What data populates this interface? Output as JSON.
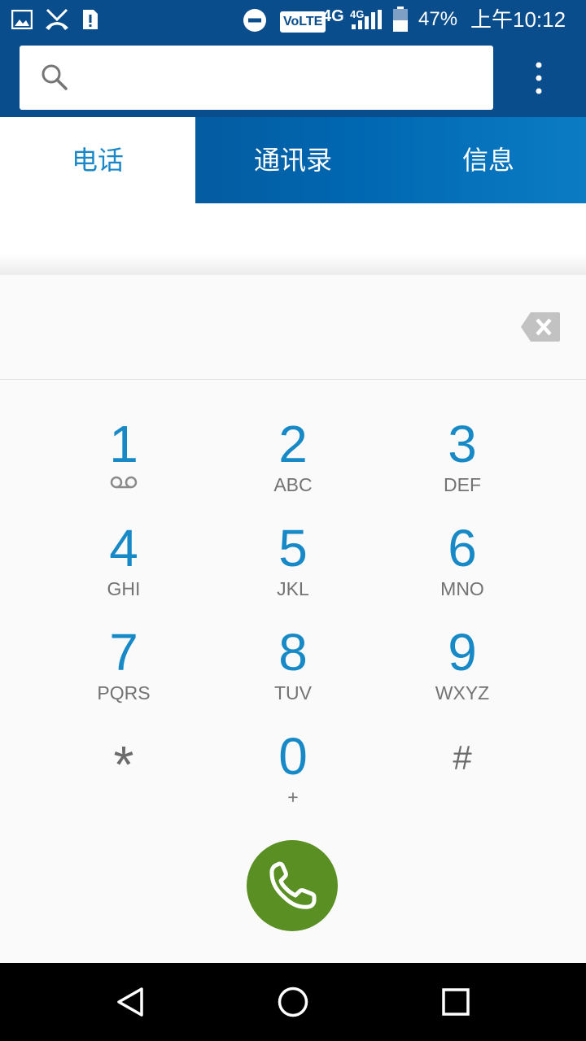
{
  "status_bar": {
    "battery": "47%",
    "time": "上午10:12",
    "net1": "4G",
    "net2": "4G",
    "volte": "VoLTE",
    "icons": [
      "image-icon",
      "missed-call-icon",
      "sim-alert-icon",
      "do-not-disturb-icon",
      "volte-icon",
      "signal-icon",
      "battery-icon"
    ]
  },
  "search": {
    "placeholder": "",
    "icon": "search-icon"
  },
  "tabs": [
    {
      "label": "电话",
      "active": true
    },
    {
      "label": "通讯录",
      "active": false
    },
    {
      "label": "信息",
      "active": false
    }
  ],
  "dial": {
    "entered_number": ""
  },
  "keys": [
    {
      "digit": "1",
      "letters": ""
    },
    {
      "digit": "2",
      "letters": "ABC"
    },
    {
      "digit": "3",
      "letters": "DEF"
    },
    {
      "digit": "4",
      "letters": "GHI"
    },
    {
      "digit": "5",
      "letters": "JKL"
    },
    {
      "digit": "6",
      "letters": "MNO"
    },
    {
      "digit": "7",
      "letters": "PQRS"
    },
    {
      "digit": "8",
      "letters": "TUV"
    },
    {
      "digit": "9",
      "letters": "WXYZ"
    },
    {
      "digit": "*",
      "letters": ""
    },
    {
      "digit": "0",
      "letters": "+"
    },
    {
      "digit": "#",
      "letters": ""
    }
  ],
  "colors": {
    "header": "#0a4d8c",
    "accent": "#1789c6",
    "call": "#5a8f24"
  }
}
